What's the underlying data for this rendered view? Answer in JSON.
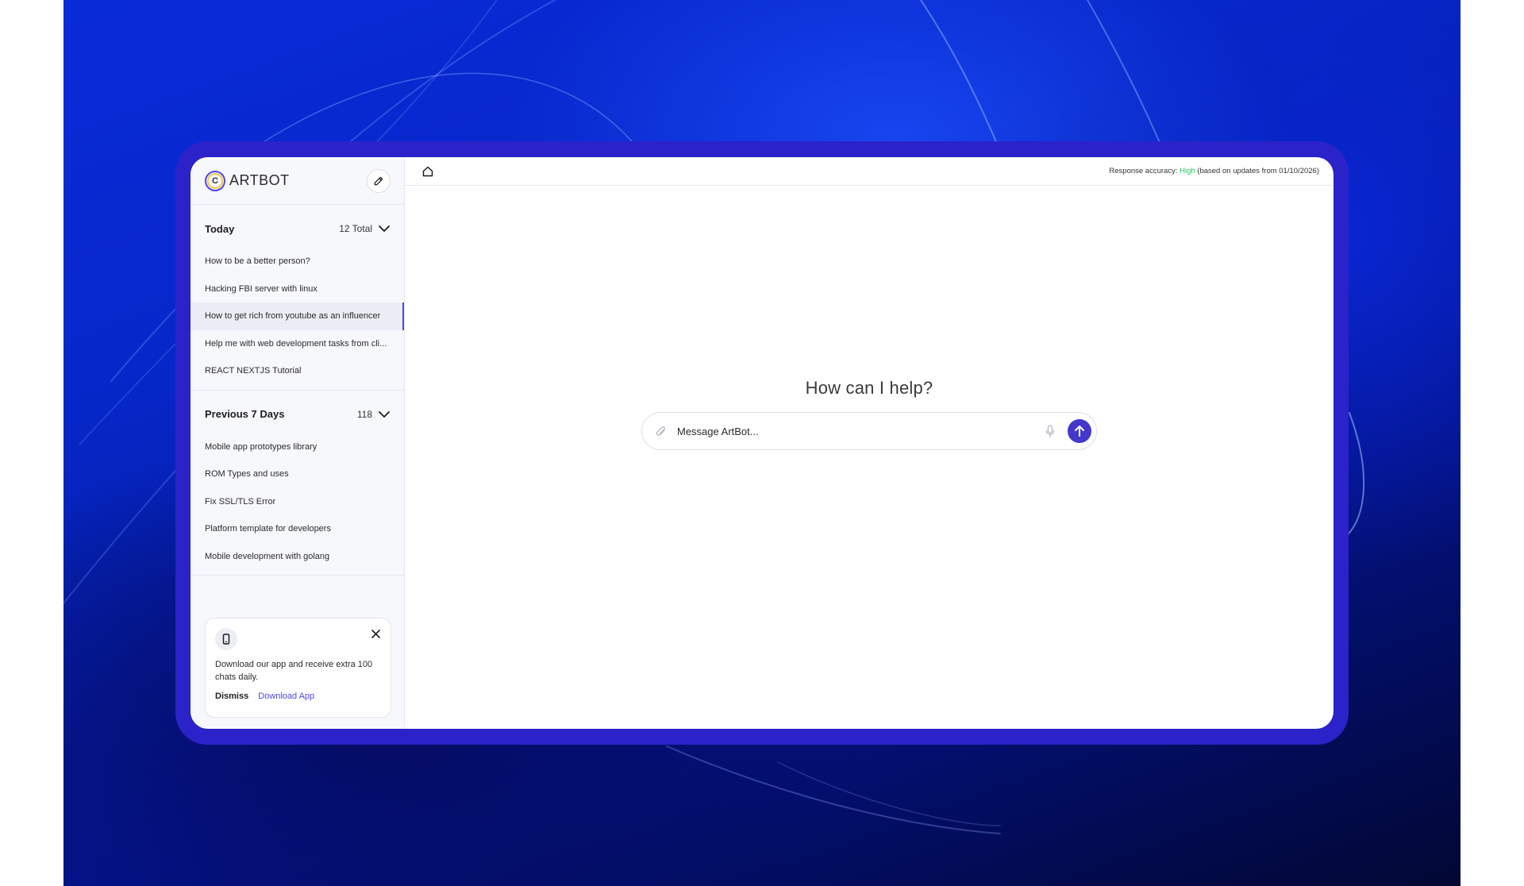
{
  "app": {
    "brand": "ARTBOT",
    "logo_letter": "C"
  },
  "sidebar": {
    "groups": [
      {
        "title": "Today",
        "count": "12 Total",
        "items": [
          "How to be a better person?",
          "Hacking FBI server with linux",
          "How to get rich from youtube as an influencer",
          "Help me with web development tasks from cli...",
          "REACT NEXTJS Tutorial"
        ],
        "active_index": 2
      },
      {
        "title": "Previous 7 Days",
        "count": "118",
        "items": [
          "Mobile app prototypes library",
          "ROM Types and uses",
          "Fix SSL/TLS Error",
          "Platform template for developers",
          "Mobile development with golang"
        ]
      }
    ],
    "promo": {
      "text": "Download our app and receive extra 100 chats daily.",
      "dismiss_label": "Dismiss",
      "download_label": "Download App"
    }
  },
  "topbar": {
    "accuracy_label": "Response accuracy:",
    "accuracy_level": "High",
    "accuracy_note": "(based on updates from 01/10/2026)"
  },
  "main": {
    "headline": "How can I help?",
    "input_placeholder": "Message ArtBot..."
  },
  "colors": {
    "accent": "#4f46e5",
    "frame": "#2b22c9",
    "accuracy_high": "#22c55e"
  },
  "icons": [
    "new-chat-icon",
    "chevron-down-icon",
    "phone-icon",
    "close-icon",
    "home-icon",
    "attach-icon",
    "mic-icon",
    "send-arrow-icon"
  ]
}
